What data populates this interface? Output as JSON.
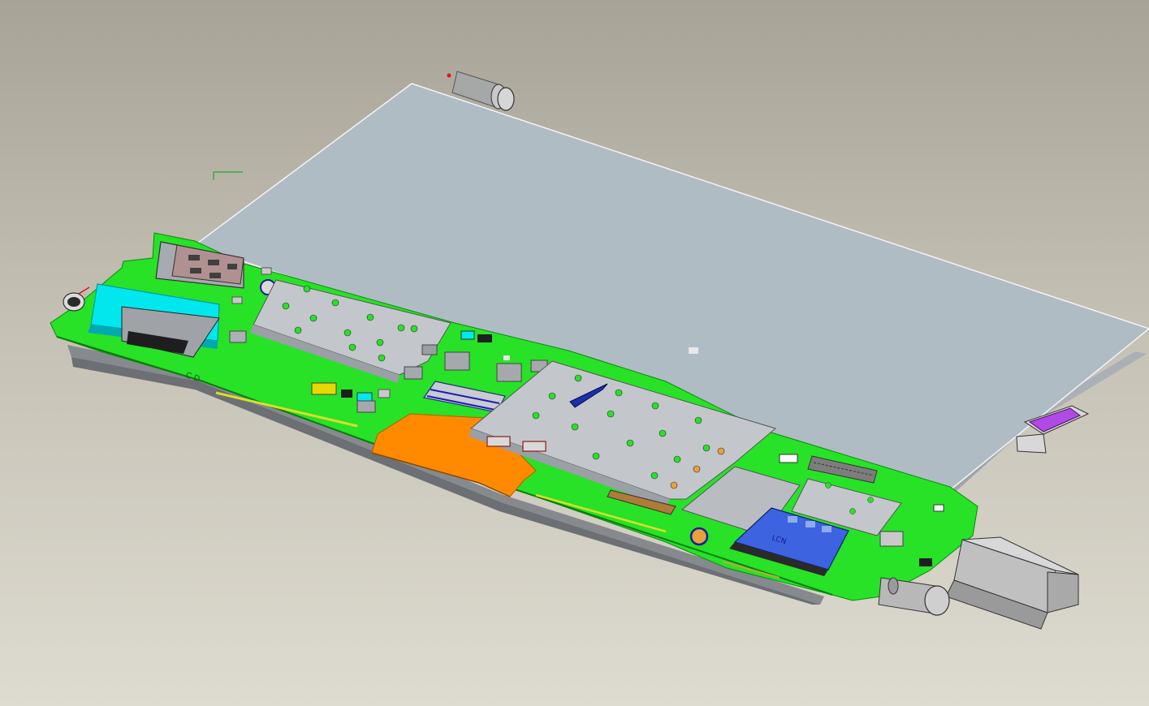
{
  "viewport": {
    "background_top": "#a7a397",
    "background_bottom": "#dedbd0"
  },
  "model": {
    "panel_color": "#b0bcc4",
    "board_color": "#27e227",
    "flex_cable_color": "#ff8a00",
    "battery_color": "#00e8ee",
    "sd_slot_color": "#3d63e0",
    "shield_color": "#c3c7cb",
    "marker_color": "#b049e6",
    "sd_slot_marking": "LCN",
    "silkscreen_mark": "C D"
  }
}
